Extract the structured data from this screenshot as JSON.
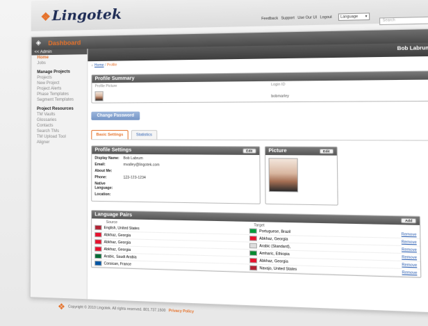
{
  "brand": {
    "name": "Lingotek",
    "mark": "❖"
  },
  "toplinks": [
    "Feedback",
    "Support",
    "Use Our UI",
    "Logout"
  ],
  "lang_select": "Language",
  "search_placeholder": "Search",
  "dashboard": {
    "title": "Dashboard",
    "user": "Bob Labrum"
  },
  "sidebar": {
    "admin": "<< Admin",
    "top": [
      {
        "label": "Home",
        "active": true
      },
      {
        "label": "Jobs",
        "active": false
      }
    ],
    "manage_projects": {
      "heading": "Manage Projects",
      "items": [
        "Projects",
        "New Project",
        "Project Alerts",
        "Phase Templates",
        "Segment Templates"
      ]
    },
    "project_resources": {
      "heading": "Project Resources",
      "items": [
        "TM Vaults",
        "Glossaries",
        "Contacts",
        "Search TMs",
        "TM Upload Tool",
        "Aligner"
      ]
    }
  },
  "breadcrumb": {
    "home": "Home",
    "sep": "/",
    "current": "Profile"
  },
  "profile_summary": {
    "title": "Profile Summary",
    "picture_label": "Profile Picture",
    "login_label": "Login ID",
    "login_value": "bobmarley"
  },
  "change_password": "Change Password",
  "tabs": [
    "Basic Settings",
    "Statistics"
  ],
  "profile_settings": {
    "title": "Profile Settings",
    "edit": "Edit",
    "rows": [
      {
        "label": "Display Name:",
        "value": "Bob Labrum"
      },
      {
        "label": "Email:",
        "value": "mvalley@lingotek.com"
      },
      {
        "label": "About Me:",
        "value": ""
      },
      {
        "label": "Phone:",
        "value": "123-123-1234"
      },
      {
        "label": "Native Language:",
        "value": ""
      },
      {
        "label": "Location:",
        "value": ""
      }
    ]
  },
  "picture_panel": {
    "title": "Picture",
    "edit": "Edit"
  },
  "language_pairs": {
    "title": "Language Pairs",
    "add": "Add",
    "col_source": "Source",
    "col_target": "Target",
    "remove": "Remove",
    "rows": [
      {
        "src": "English, United States",
        "src_flag": "#b22234",
        "tgt": "Portuguese, Brazil",
        "tgt_flag": "#009c3b"
      },
      {
        "src": "Abkhaz, Georgia",
        "src_flag": "#e8112d",
        "tgt": "Abkhaz, Georgia",
        "tgt_flag": "#e8112d"
      },
      {
        "src": "Abkhaz, Georgia",
        "src_flag": "#e8112d",
        "tgt": "Arabic (Standard),",
        "tgt_flag": "#dddddd"
      },
      {
        "src": "Abkhaz, Georgia",
        "src_flag": "#e8112d",
        "tgt": "Amharic, Ethiopia",
        "tgt_flag": "#078930"
      },
      {
        "src": "Arabic, Saudi Arabia",
        "src_flag": "#006c35",
        "tgt": "Abkhaz, Georgia",
        "tgt_flag": "#e8112d"
      },
      {
        "src": "Corsican, France",
        "src_flag": "#0055a4",
        "tgt": "Navajo, United States",
        "tgt_flag": "#b22234"
      }
    ]
  },
  "footer": {
    "text": "Copyright © 2010 Lingotek. All rights reserved. 801.737.1500",
    "privacy": "Privacy Policy"
  }
}
